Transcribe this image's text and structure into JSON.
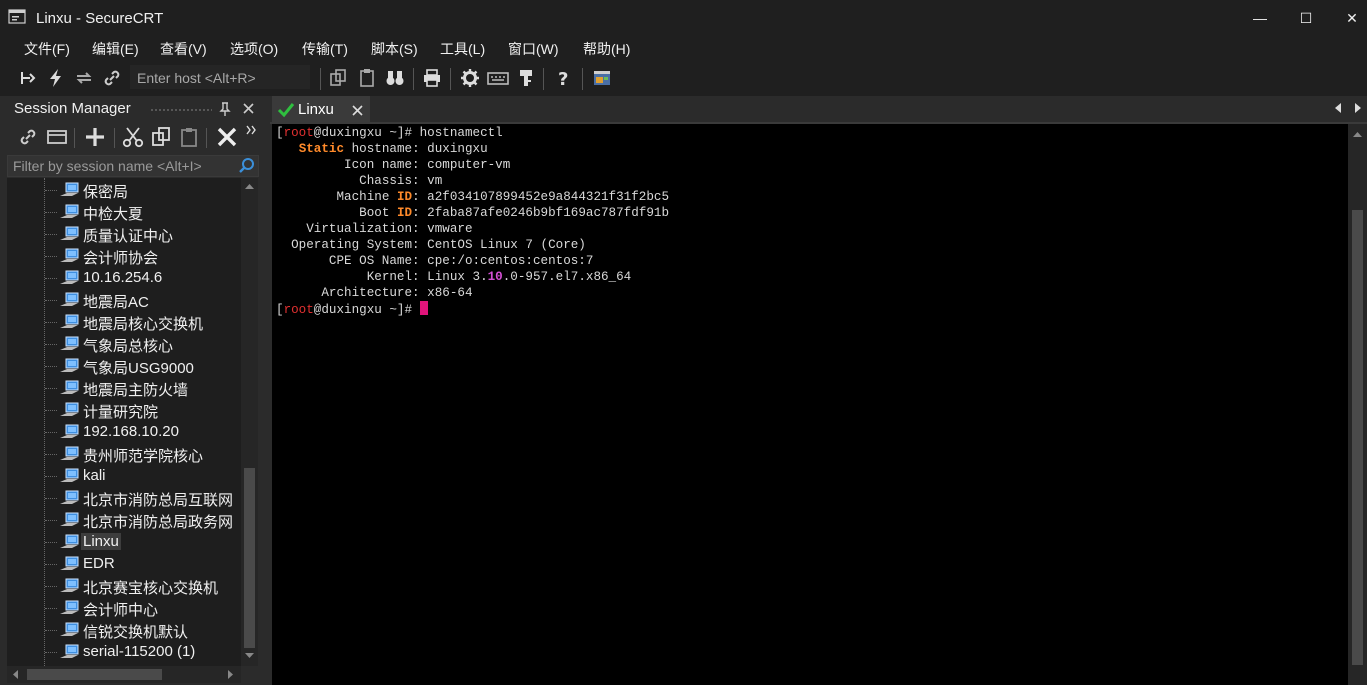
{
  "window": {
    "title": "Linxu - SecureCRT",
    "minimize": "—",
    "maximize": "☐",
    "close": "✕"
  },
  "menu": [
    "文件(F)",
    "编辑(E)",
    "查看(V)",
    "选项(O)",
    "传输(T)",
    "脚本(S)",
    "工具(L)",
    "窗口(W)",
    "帮助(H)"
  ],
  "toolbar": {
    "quick_connect_placeholder": "Enter host <Alt+R>"
  },
  "session_manager": {
    "title": "Session Manager",
    "filter_placeholder": "Filter by session name <Alt+I>",
    "sessions": [
      "保密局",
      "中检大夏",
      "质量认证中心",
      "会计师协会",
      "10.16.254.6",
      "地震局AC",
      "地震局核心交换机",
      "气象局总核心",
      "气象局USG9000",
      "地震局主防火墙",
      "计量研究院",
      "192.168.10.20",
      "贵州师范学院核心",
      "kali",
      "北京市消防总局互联网",
      "北京市消防总局政务网",
      "Linxu",
      "EDR",
      "北京赛宝核心交换机",
      "会计师中心",
      "信锐交换机默认",
      "serial-115200 (1)"
    ],
    "selected": "Linxu"
  },
  "tab": {
    "label": "Linxu"
  },
  "terminal": {
    "prompt_open": "[",
    "user": "root",
    "host_dir": "@duxingxu ~]# ",
    "command": "hostnamectl",
    "static_label": "Static",
    "static_rest": " hostname: duxingxu",
    "icon_name": "Icon name: computer-vm",
    "chassis": "Chassis: vm",
    "machine_pre": "Machine ",
    "id_word": "ID",
    "machine_val": ": a2f034107899452e9a844321f31f2bc5",
    "boot_pre": "Boot ",
    "boot_val": ": 2faba87afe0246b9bf169ac787fdf91b",
    "virtualization": "Virtualization: vmware",
    "os": "Operating System: CentOS Linux 7 (Core)",
    "cpe": "CPE OS Name: cpe:/o:centos:centos:7",
    "kernel_pre": "Kernel: Linux 3.",
    "kernel_hl": "10",
    "kernel_post": ".0-957.el7.x86_64",
    "arch": "Architecture: x86-64"
  }
}
